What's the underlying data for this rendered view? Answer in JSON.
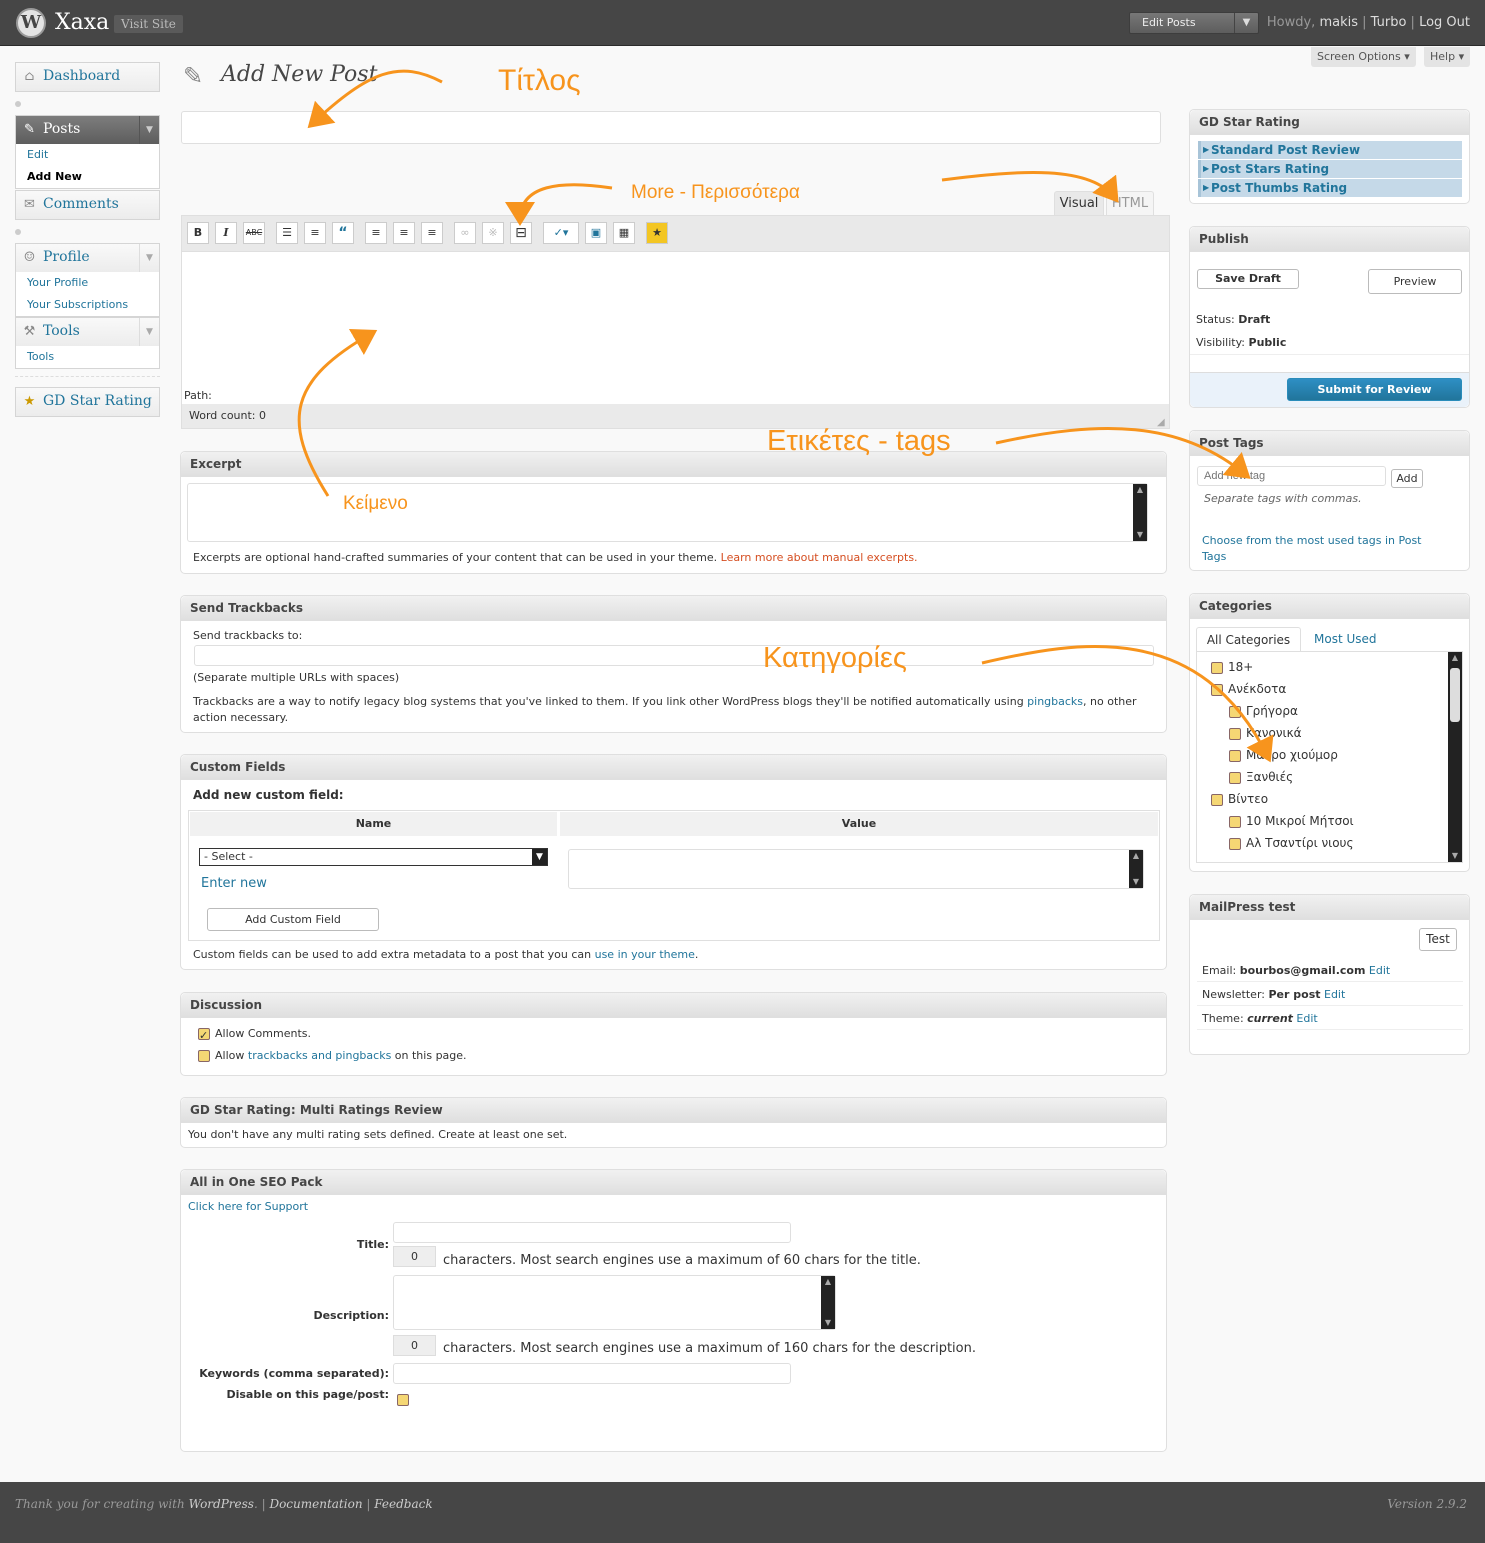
{
  "header": {
    "site_name": "Xaxa",
    "visit_site": "Visit Site",
    "favorites": "Edit Posts",
    "howdy": "Howdy,",
    "user": "makis",
    "turbo": "Turbo",
    "logout": "Log Out",
    "screen_options": "Screen Options",
    "help": "Help"
  },
  "menu": {
    "dashboard": "Dashboard",
    "posts": "Posts",
    "edit": "Edit",
    "add_new": "Add New",
    "comments": "Comments",
    "profile": "Profile",
    "your_profile": "Your Profile",
    "your_subscriptions": "Your Subscriptions",
    "tools": "Tools",
    "tools_sub": "Tools",
    "gd_star": "GD Star Rating"
  },
  "page_title": "Add New Post",
  "editor": {
    "visual": "Visual",
    "html": "HTML",
    "path": "Path:",
    "word_count": "Word count: 0"
  },
  "excerpt": {
    "title": "Excerpt",
    "help": "Excerpts are optional hand-crafted summaries of your content that can be used in your theme.",
    "link": "Learn more about manual excerpts."
  },
  "trackbacks": {
    "title": "Send Trackbacks",
    "label": "Send trackbacks to:",
    "hint": "(Separate multiple URLs with spaces)",
    "help1": "Trackbacks are a way to notify legacy blog systems that you've linked to them. If you link other WordPress blogs they'll be notified automatically using",
    "pingbacks": "pingbacks",
    "help2": ", no other action necessary."
  },
  "custom_fields": {
    "title": "Custom Fields",
    "add_new": "Add new custom field:",
    "name_col": "Name",
    "value_col": "Value",
    "select": "- Select -",
    "enter_new": "Enter new",
    "add_button": "Add Custom Field",
    "help1": "Custom fields can be used to add extra metadata to a post that you can",
    "help_link": "use in your theme",
    "help2": "."
  },
  "discussion": {
    "title": "Discussion",
    "allow_comments": "Allow Comments.",
    "allow": "Allow",
    "tb_link": "trackbacks and pingbacks",
    "on_page": "on this page."
  },
  "gd_multi": {
    "title": "GD Star Rating: Multi Ratings Review",
    "text": "You don't have any multi rating sets defined. Create at least one set."
  },
  "seo": {
    "title": "All in One SEO Pack",
    "support": "Click here for Support",
    "title_label": "Title:",
    "title_count": "0",
    "title_help": "characters. Most search engines use a maximum of 60 chars for the title.",
    "desc_label": "Description:",
    "desc_count": "0",
    "desc_help": "characters. Most search engines use a maximum of 160 chars for the description.",
    "keywords_label": "Keywords (comma separated):",
    "disable_label": "Disable on this page/post:"
  },
  "gdstar": {
    "title": "GD Star Rating",
    "items": [
      "Standard Post Review",
      "Post Stars Rating",
      "Post Thumbs Rating"
    ]
  },
  "publish": {
    "title": "Publish",
    "save_draft": "Save Draft",
    "preview": "Preview",
    "status_label": "Status:",
    "status": "Draft",
    "visibility_label": "Visibility:",
    "visibility": "Public",
    "submit": "Submit for Review"
  },
  "tags": {
    "title": "Post Tags",
    "placeholder": "Add new tag",
    "add": "Add",
    "hint": "Separate tags with commas.",
    "choose": "Choose from the most used tags in Post Tags"
  },
  "categories": {
    "title": "Categories",
    "tab_all": "All Categories",
    "tab_most": "Most Used",
    "items": [
      "18+",
      "Ανέκδοτα",
      "Γρήγορα",
      "Κανονικά",
      "Μαύρο χιούμορ",
      "Ξανθιές",
      "Βίντεο",
      "10 Μικροί Μήτσοι",
      "Αλ Τσαντίρι νιους"
    ]
  },
  "mailpress": {
    "title": "MailPress test",
    "test": "Test",
    "email_label": "Email:",
    "email": "bourbos@gmail.com",
    "newsletter_label": "Newsletter:",
    "newsletter": "Per post",
    "theme_label": "Theme:",
    "theme": "current",
    "edit": "Edit"
  },
  "annotations": {
    "title": "Τίτλος",
    "more": "More - Περισσότερα",
    "text": "Κείμενο",
    "tags": "Ετικέτες - tags",
    "categories": "Κατηγορίες"
  },
  "footer": {
    "thanks": "Thank you for creating with",
    "wordpress": "WordPress",
    "documentation": "Documentation",
    "feedback": "Feedback",
    "version": "Version 2.9.2"
  }
}
